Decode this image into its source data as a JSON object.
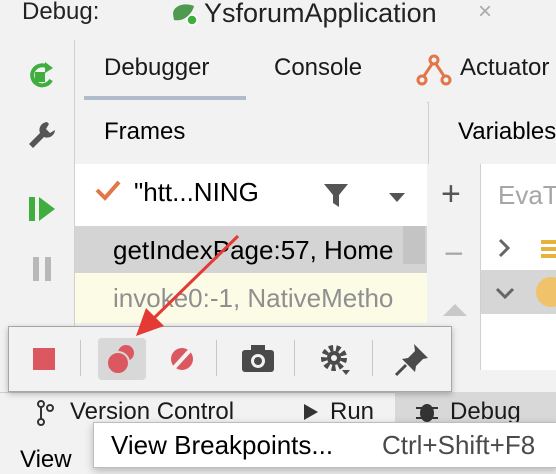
{
  "window": {
    "debug_label": "Debug:",
    "app_title": "YsforumApplication",
    "close_glyph": "×"
  },
  "tabs": {
    "debugger": "Debugger",
    "console": "Console",
    "actuator": "Actuator"
  },
  "frames": {
    "title": "Frames",
    "thread": "\"htt...NING",
    "items": [
      {
        "label": "getIndexPage:57, Home"
      },
      {
        "label": "invoke0:-1, NativeMetho"
      }
    ]
  },
  "variables": {
    "title": "Variables",
    "eval_placeholder": "EvaT"
  },
  "popup_toolbar": {
    "buttons": [
      "stop-icon",
      "view-breakpoints-icon",
      "mute-breakpoints-icon",
      "camera-icon",
      "settings-icon",
      "pin-icon"
    ]
  },
  "bottom_bar": {
    "version_control": "Version Control",
    "run": "Run",
    "debug": "Debug",
    "view": "View"
  },
  "context_menu": {
    "item_label": "View Breakpoints...",
    "item_shortcut": "Ctrl+Shift+F8"
  },
  "colors": {
    "accent_green": "#3fae3f",
    "stop_red": "#db5860",
    "annotation_red": "#e53935",
    "tab_underline": "#b0bccb"
  }
}
